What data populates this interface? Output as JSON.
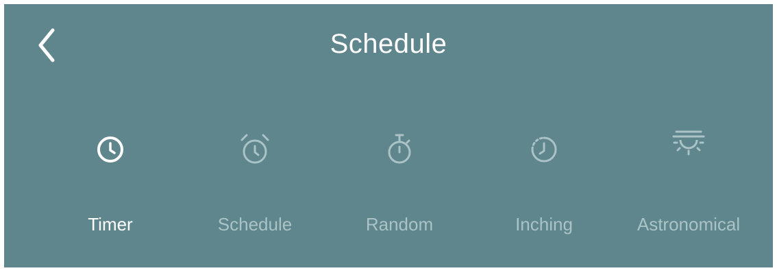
{
  "header": {
    "title": "Schedule",
    "back_icon": "chevron-left-icon"
  },
  "tabs": [
    {
      "id": "timer",
      "label": "Timer",
      "icon": "clock-icon",
      "active": true
    },
    {
      "id": "schedule",
      "label": "Schedule",
      "icon": "alarm-clock-icon",
      "active": false
    },
    {
      "id": "random",
      "label": "Random",
      "icon": "stopwatch-icon",
      "active": false
    },
    {
      "id": "inching",
      "label": "Inching",
      "icon": "dashed-clock-icon",
      "active": false
    },
    {
      "id": "astronomical",
      "label": "Astronomical",
      "icon": "sunset-icon",
      "active": false
    }
  ],
  "colors": {
    "background": "#5f868c",
    "active": "#ffffff",
    "inactive": "#a9c3c7"
  }
}
